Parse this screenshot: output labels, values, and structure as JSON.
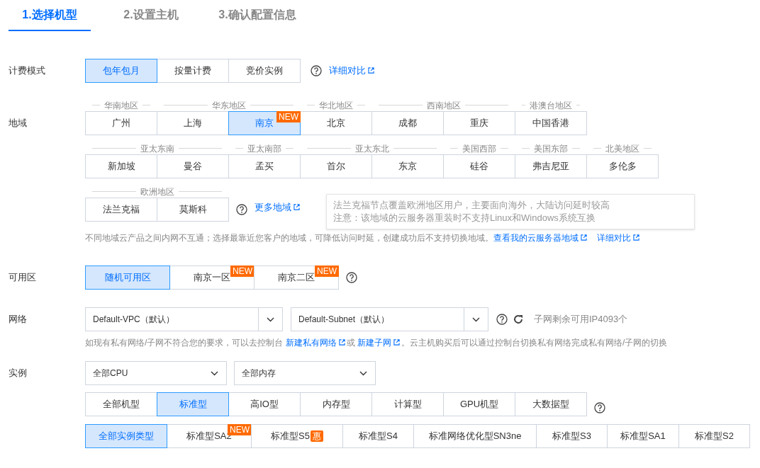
{
  "steps": [
    {
      "label": "1.选择机型",
      "selected": true
    },
    {
      "label": "2.设置主机",
      "selected": false
    },
    {
      "label": "3.确认配置信息",
      "selected": false
    }
  ],
  "billing": {
    "label": "计费模式",
    "options": [
      {
        "label": "包年包月",
        "selected": true
      },
      {
        "label": "按量计费",
        "selected": false
      },
      {
        "label": "竞价实例",
        "selected": false
      }
    ],
    "link": "详细对比"
  },
  "region": {
    "label": "地域",
    "rows": [
      [
        {
          "group": "华南地区",
          "cities": [
            {
              "label": "广州",
              "selected": false
            }
          ]
        },
        {
          "group": "华东地区",
          "cities": [
            {
              "label": "上海",
              "selected": false
            },
            {
              "label": "南京",
              "selected": true,
              "badge": "NEW"
            }
          ]
        },
        {
          "group": "华北地区",
          "cities": [
            {
              "label": "北京",
              "selected": false
            }
          ]
        },
        {
          "group": "西南地区",
          "cities": [
            {
              "label": "成都",
              "selected": false
            },
            {
              "label": "重庆",
              "selected": false
            }
          ]
        },
        {
          "group": "港澳台地区",
          "cities": [
            {
              "label": "中国香港",
              "selected": false
            }
          ]
        }
      ],
      [
        {
          "group": "亚太东南",
          "cities": [
            {
              "label": "新加坡",
              "selected": false
            },
            {
              "label": "曼谷",
              "selected": false
            }
          ]
        },
        {
          "group": "亚太南部",
          "cities": [
            {
              "label": "孟买",
              "selected": false
            }
          ]
        },
        {
          "group": "亚太东北",
          "cities": [
            {
              "label": "首尔",
              "selected": false
            },
            {
              "label": "东京",
              "selected": false
            }
          ]
        },
        {
          "group": "美国西部",
          "cities": [
            {
              "label": "硅谷",
              "selected": false
            }
          ]
        },
        {
          "group": "美国东部",
          "cities": [
            {
              "label": "弗吉尼亚",
              "selected": false
            }
          ]
        },
        {
          "group": "北美地区",
          "cities": [
            {
              "label": "多伦多",
              "selected": false
            }
          ]
        }
      ],
      [
        {
          "group": "欧洲地区",
          "cities": [
            {
              "label": "法兰克福",
              "selected": false
            },
            {
              "label": "莫斯科",
              "selected": false
            }
          ]
        }
      ]
    ],
    "more_link": "更多地域",
    "tooltip": [
      "法兰克福节点覆盖欧洲地区用户，主要面向海外，大陆访问延时较高",
      "注意：该地域的云服务器重装时不支持Linux和Windows系统互换"
    ],
    "note": [
      {
        "text": "不同地域云产品之间内网不互通；选择最靠近您客户的地域，可降低访问时延，创建成功后不支持切换地域。"
      },
      {
        "text": "查看我的云服务器地域",
        "kind": "link"
      },
      {
        "text": "详细对比",
        "kind": "link"
      }
    ]
  },
  "zone": {
    "label": "可用区",
    "options": [
      {
        "label": "随机可用区",
        "selected": true
      },
      {
        "label": "南京一区",
        "selected": false,
        "badge": "NEW"
      },
      {
        "label": "南京二区",
        "selected": false,
        "badge": "NEW"
      }
    ]
  },
  "network": {
    "label": "网络",
    "selects": [
      "Default-VPC（默认）",
      "Default-Subnet（默认）"
    ],
    "remaining": "子网剩余可用IP4093个",
    "note": [
      {
        "text": "如现有私有网络/子网不符合您的要求，可以去控制台 "
      },
      {
        "text": "新建私有网络",
        "kind": "link"
      },
      {
        "text": "或 "
      },
      {
        "text": "新建子网",
        "kind": "link"
      },
      {
        "text": "。云主机购买后可以通过控制台切换私有网络完成私有网络/子网的切换"
      }
    ]
  },
  "instance": {
    "label": "实例",
    "selects": [
      "全部CPU",
      "全部内存"
    ],
    "families": [
      {
        "label": "全部机型",
        "selected": false
      },
      {
        "label": "标准型",
        "selected": true
      },
      {
        "label": "高IO型",
        "selected": false
      },
      {
        "label": "内存型",
        "selected": false
      },
      {
        "label": "计算型",
        "selected": false
      },
      {
        "label": "GPU机型",
        "selected": false
      },
      {
        "label": "大数据型",
        "selected": false
      }
    ],
    "types": [
      {
        "label": "全部实例类型",
        "selected": true
      },
      {
        "label": "标准型SA2",
        "selected": false,
        "badge": "NEW"
      },
      {
        "label": "标准型S5",
        "selected": false,
        "badge": "惠"
      },
      {
        "label": "标准型S4",
        "selected": false
      },
      {
        "label": "标准网络优化型SN3ne",
        "selected": false
      },
      {
        "label": "标准型S3",
        "selected": false
      },
      {
        "label": "标准型SA1",
        "selected": false
      },
      {
        "label": "标准型S2",
        "selected": false
      }
    ]
  }
}
